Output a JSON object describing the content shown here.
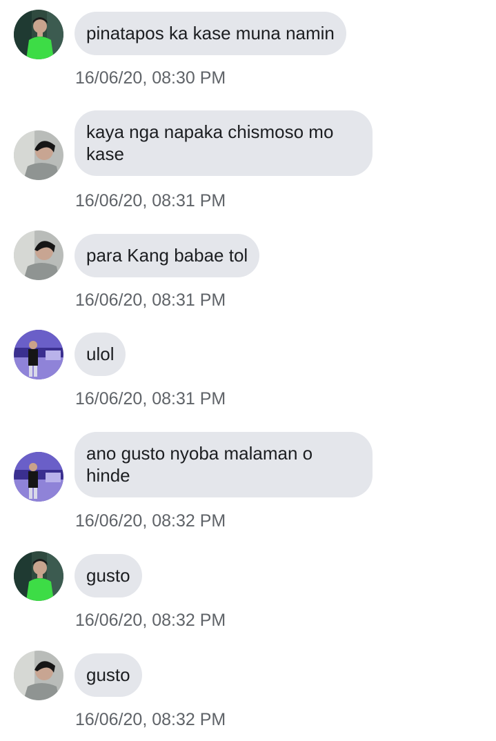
{
  "messages": [
    {
      "avatar": "green-shirt-avatar",
      "text": "pinatapos ka kase muna namin",
      "timestamp": "16/06/20, 08:30 PM"
    },
    {
      "avatar": "gray-sweater-avatar",
      "text": "kaya nga napaka chismoso mo kase",
      "timestamp": "16/06/20, 08:31 PM"
    },
    {
      "avatar": "gray-sweater-avatar",
      "text": "para Kang babae tol",
      "timestamp": "16/06/20, 08:31 PM"
    },
    {
      "avatar": "stage-purple-avatar",
      "text": "ulol",
      "timestamp": "16/06/20, 08:31 PM"
    },
    {
      "avatar": "stage-purple-avatar",
      "text": "ano gusto nyoba malaman o hinde",
      "timestamp": "16/06/20, 08:32 PM"
    },
    {
      "avatar": "green-shirt-avatar",
      "text": "gusto",
      "timestamp": "16/06/20, 08:32 PM"
    },
    {
      "avatar": "gray-sweater-avatar",
      "text": "gusto",
      "timestamp": "16/06/20, 08:32 PM"
    }
  ],
  "colors": {
    "bubble": "#e4e6eb",
    "text": "#1c1e21",
    "timestamp": "#5f6368"
  }
}
